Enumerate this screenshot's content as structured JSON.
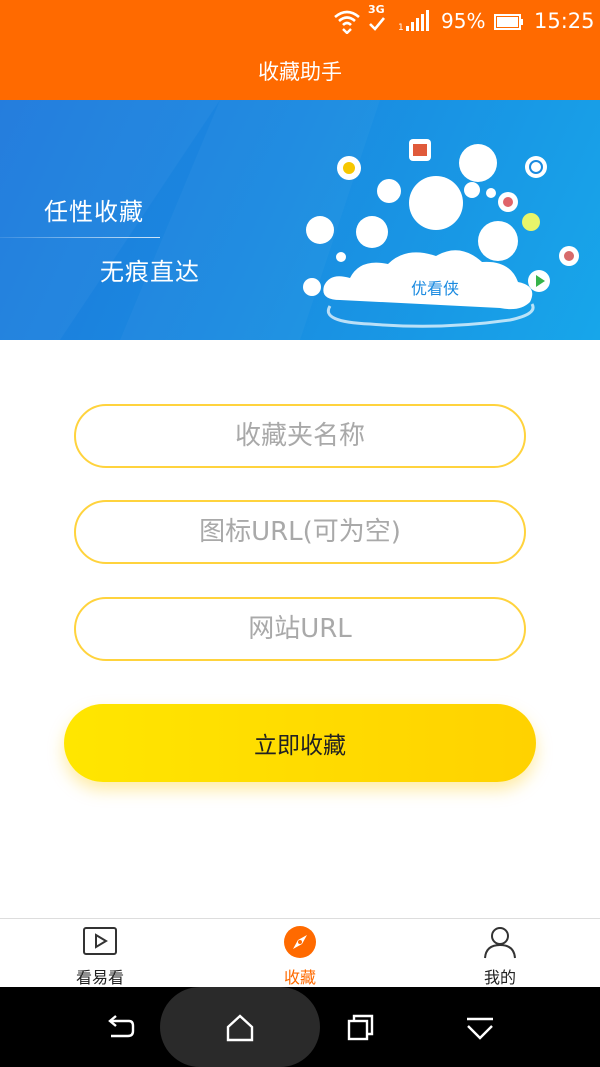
{
  "status_bar": {
    "network": "3G",
    "battery": "95%",
    "time": "15:25"
  },
  "header": {
    "title": "收藏助手"
  },
  "banner": {
    "line1": "任性收藏",
    "line2": "无痕直达",
    "cloud_label": "优看侠"
  },
  "form": {
    "name_placeholder": "收藏夹名称",
    "icon_url_placeholder": "图标URL(可为空)",
    "site_url_placeholder": "网站URL",
    "submit_label": "立即收藏"
  },
  "tabbar": {
    "tabs": [
      {
        "label": "看易看",
        "icon": "play-video-icon"
      },
      {
        "label": "收藏",
        "icon": "compass-icon",
        "active": true
      },
      {
        "label": "我的",
        "icon": "user-profile-icon"
      }
    ]
  },
  "navbar": {
    "buttons": [
      "back-icon",
      "home-icon",
      "recent-apps-icon",
      "notification-drawer-icon"
    ]
  },
  "colors": {
    "primary": "#ff6a00",
    "banner": "#1a8ae0",
    "field_border": "#ffd33d",
    "button": "#ffe000"
  }
}
